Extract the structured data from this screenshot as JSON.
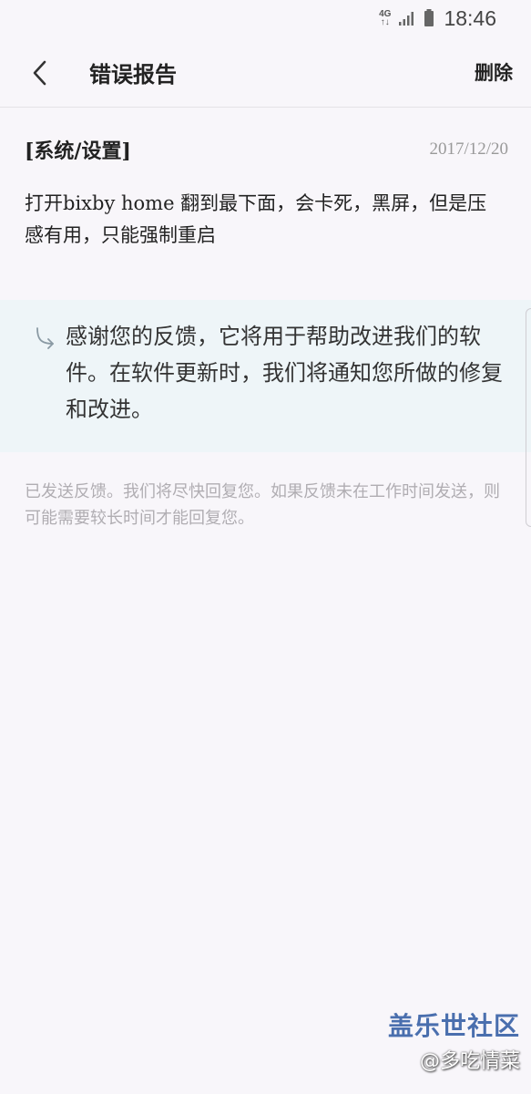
{
  "status_bar": {
    "network_top": "4G",
    "network_bottom": "↑↓",
    "time": "18:46"
  },
  "app_bar": {
    "back_icon": "chevron-left-icon",
    "title": "错误报告",
    "delete_label": "删除"
  },
  "report": {
    "category": "[系统/设置]",
    "date": "2017/12/20",
    "body": "打开bixby home 翻到最下面，会卡死，黑屏，但是压感有用，只能强制重启"
  },
  "reply": {
    "icon": "reply-arrow-icon",
    "text": "感谢您的反馈，它将用于帮助改进我们的软件。在软件更新时，我们将通知您所做的修复和改进。"
  },
  "footer_note": "已发送反馈。我们将尽快回复您。如果反馈未在工作时间发送，则可能需要较长时间才能回复您。",
  "watermark": {
    "line1": "盖乐世社区",
    "line2": "@多吃情菜"
  }
}
